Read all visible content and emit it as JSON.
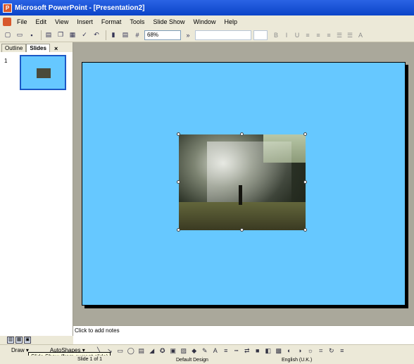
{
  "window": {
    "title": "Microsoft PowerPoint - [Presentation2]"
  },
  "menu": [
    "File",
    "Edit",
    "View",
    "Insert",
    "Format",
    "Tools",
    "Slide Show",
    "Window",
    "Help"
  ],
  "toolbar": {
    "zoom": "68%"
  },
  "left_pane": {
    "tabs": [
      "Outline",
      "Slides"
    ],
    "close_glyph": "×",
    "slides": [
      {
        "number": "1"
      }
    ]
  },
  "notes": {
    "placeholder": "Click to add notes"
  },
  "drawing_toolbar": {
    "draw_label": "Draw ▾",
    "autoshapes_label": "AutoShapes ▾"
  },
  "tooltip": {
    "text": "Slide Show (from current slide)"
  },
  "status_bar": {
    "slide": "Slide 1 of 1",
    "design": "Default Design",
    "language": "English (U.K.)"
  },
  "colors": {
    "slide_bg": "#66c8ff",
    "title_bar": "#0b44c8",
    "chrome": "#ece9d8"
  }
}
